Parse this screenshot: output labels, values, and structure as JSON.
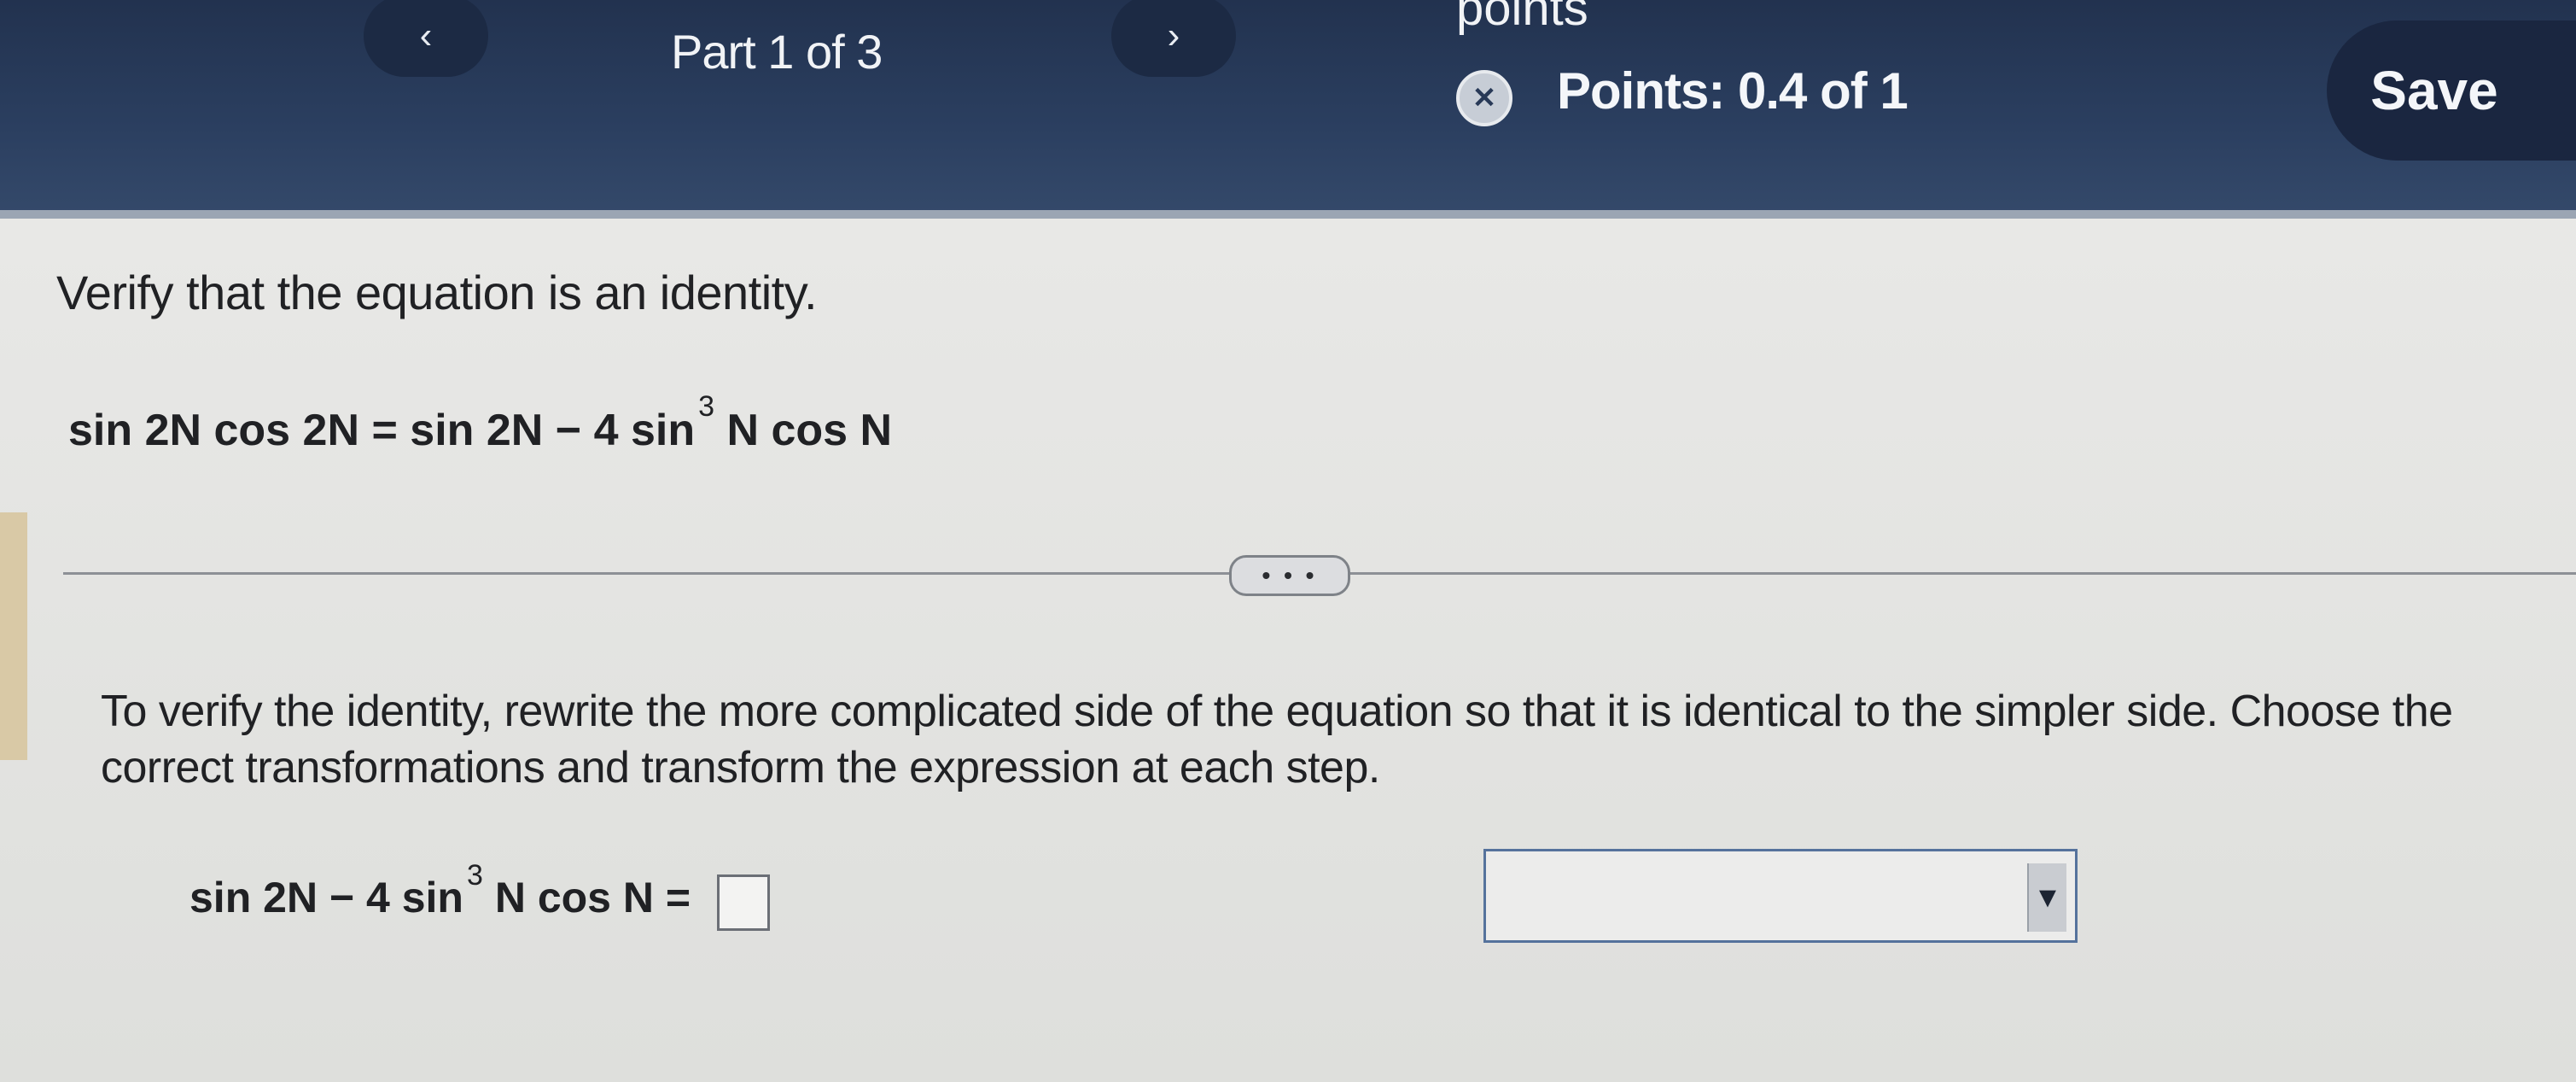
{
  "header": {
    "prev_icon": "chevron-left-icon",
    "prev_glyph": "‹",
    "next_icon": "chevron-right-icon",
    "next_glyph": "›",
    "part_label": "Part 1 of 3",
    "points_top": "points",
    "points_icon_glyph": "✕",
    "points_label": "Points: 0.4 of 1",
    "save_label": "Save"
  },
  "question": {
    "instruction": "Verify that the equation is an identity.",
    "equation_lhs_part": "sin 2N cos 2N = sin 2N − 4 sin",
    "equation_exponent": "3",
    "equation_rhs_tail": "N cos N",
    "more_label": "• • •",
    "prompt": "To verify the identity, rewrite the more complicated side of the equation so that it is identical to the simpler side. Choose the correct transformations and transform the expression at each step.",
    "work_part1": "sin 2N − 4 sin",
    "work_exponent": "3",
    "work_part2": "N cos N =",
    "answer_value": "",
    "dropdown_value": "",
    "dropdown_icon": "dropdown-arrow-icon",
    "dropdown_glyph": "▼"
  },
  "colors": {
    "header_bg": "#2b3f60",
    "save_bg": "#1a2640",
    "content_bg": "#e4e5e3",
    "dropdown_border": "#55729c"
  }
}
